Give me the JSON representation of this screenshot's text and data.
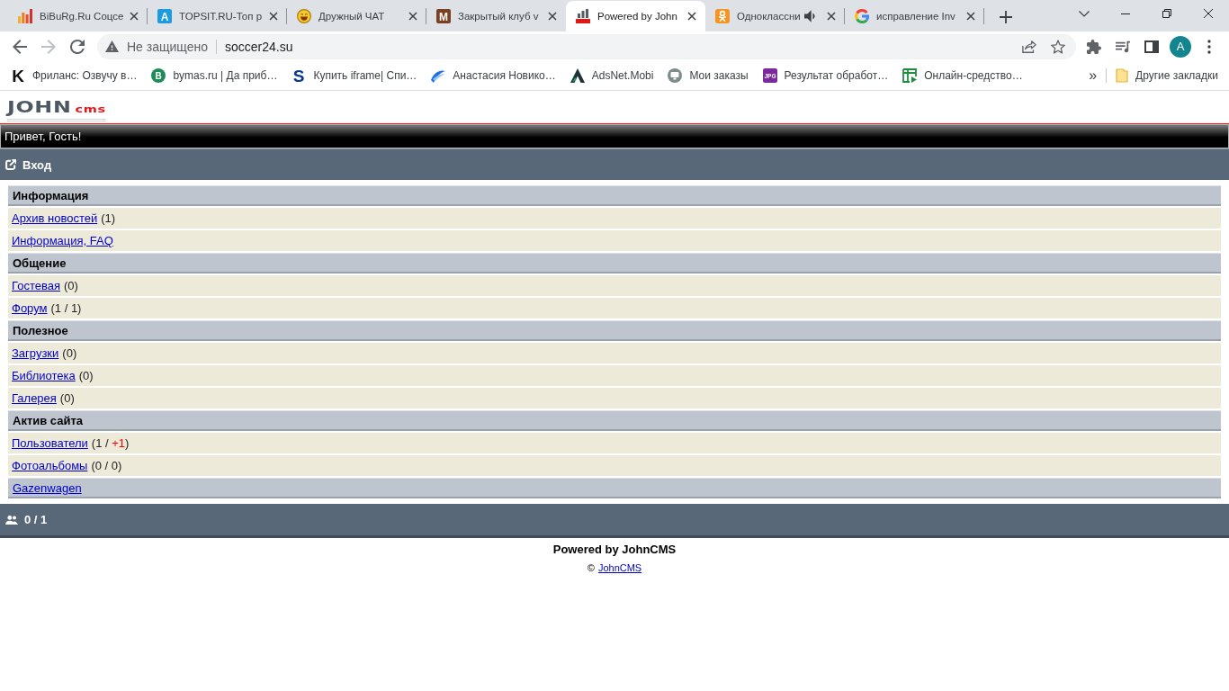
{
  "browser": {
    "tabs": [
      {
        "title": "BiBuRg.Ru Соцсе",
        "selected": false,
        "audio": false,
        "favicon": {
          "kind": "bars"
        }
      },
      {
        "title": "TOPSIT.RU-Топ р",
        "selected": false,
        "audio": false,
        "favicon": {
          "kind": "tile",
          "letter": "A",
          "color": "#1e9ae0"
        }
      },
      {
        "title": "Дружный ЧАТ",
        "selected": false,
        "audio": false,
        "favicon": {
          "kind": "smiley"
        }
      },
      {
        "title": "Закрытый клуб v",
        "selected": false,
        "audio": false,
        "favicon": {
          "kind": "tile",
          "letter": "M",
          "color": "#7b3f22"
        }
      },
      {
        "title": "Powered by John",
        "selected": true,
        "audio": false,
        "favicon": {
          "kind": "site-logo"
        }
      },
      {
        "title": "Одноклассни",
        "selected": false,
        "audio": true,
        "favicon": {
          "kind": "ok"
        }
      },
      {
        "title": "исправление Inv",
        "selected": false,
        "audio": false,
        "favicon": {
          "kind": "g-logo"
        }
      }
    ],
    "toolbar": {
      "back": {
        "disabled": false
      },
      "forward": {
        "disabled": true
      },
      "security_label": "Не защищено",
      "url": "soccer24.su",
      "avatar_letter": "A"
    },
    "bookmarks": [
      {
        "title": "Фриланс: Озвучу в…",
        "favicon": {
          "kind": "letter",
          "letter": "K",
          "color": "#111111"
        }
      },
      {
        "title": "bymas.ru | Да приб…",
        "favicon": {
          "kind": "disc",
          "letter": "B",
          "color": "#1e8c5a"
        }
      },
      {
        "title": "Купить iframe| Спи…",
        "favicon": {
          "kind": "letter",
          "letter": "S",
          "color": "#0b3a8c"
        }
      },
      {
        "title": "Анастасия Новико…",
        "favicon": {
          "kind": "swoosh"
        }
      },
      {
        "title": "AdsNet.Mobi",
        "favicon": {
          "kind": "peak"
        }
      },
      {
        "title": "Мои заказы",
        "favicon": {
          "kind": "monitor"
        }
      },
      {
        "title": "Результат обработ…",
        "favicon": {
          "kind": "tile",
          "letter": "JPG",
          "color": "#7a2a9c"
        }
      },
      {
        "title": "Онлайн-средство…",
        "favicon": {
          "kind": "sheet"
        }
      }
    ],
    "bookmarks_overflow": "»",
    "other_bookmarks": "Другие закладки"
  },
  "page": {
    "logo": {
      "main": "JOHN",
      "sub": "cms"
    },
    "greeting": "Привет, Гость!",
    "nav": {
      "label": "Вход"
    },
    "menu": [
      {
        "kind": "header",
        "label": "Информация"
      },
      {
        "kind": "item",
        "label": "Архив новостей",
        "counter": [
          {
            "kind": "plain",
            "text": "(1)"
          }
        ]
      },
      {
        "kind": "item",
        "label": "Информация, FAQ"
      },
      {
        "kind": "header",
        "label": "Общение"
      },
      {
        "kind": "item",
        "label": "Гостевая",
        "counter": [
          {
            "kind": "plain",
            "text": "(0)"
          }
        ]
      },
      {
        "kind": "item",
        "label": "Форум",
        "counter": [
          {
            "kind": "plain",
            "text": "(1 / 1)"
          }
        ]
      },
      {
        "kind": "header",
        "label": "Полезное"
      },
      {
        "kind": "item",
        "label": "Загрузки",
        "counter": [
          {
            "kind": "plain",
            "text": "(0)"
          }
        ]
      },
      {
        "kind": "item",
        "label": "Библиотека",
        "counter": [
          {
            "kind": "plain",
            "text": "(0)"
          }
        ]
      },
      {
        "kind": "item",
        "label": "Галерея",
        "counter": [
          {
            "kind": "plain",
            "text": "(0)"
          }
        ]
      },
      {
        "kind": "header",
        "label": "Актив сайта"
      },
      {
        "kind": "item",
        "label": "Пользователи",
        "counter": [
          {
            "kind": "plain",
            "text": "(1 / "
          },
          {
            "kind": "new",
            "text": "+1"
          },
          {
            "kind": "plain",
            "text": ")"
          }
        ]
      },
      {
        "kind": "item",
        "label": "Фотоальбомы",
        "counter": [
          {
            "kind": "plain",
            "text": "(0 / 0)"
          }
        ]
      },
      {
        "kind": "link-header",
        "label": "Gazenwagen"
      }
    ],
    "online": "0 / 1",
    "footer": {
      "powered": "Powered by JohnCMS",
      "copyright": "©",
      "link": "JohnCMS"
    }
  }
}
